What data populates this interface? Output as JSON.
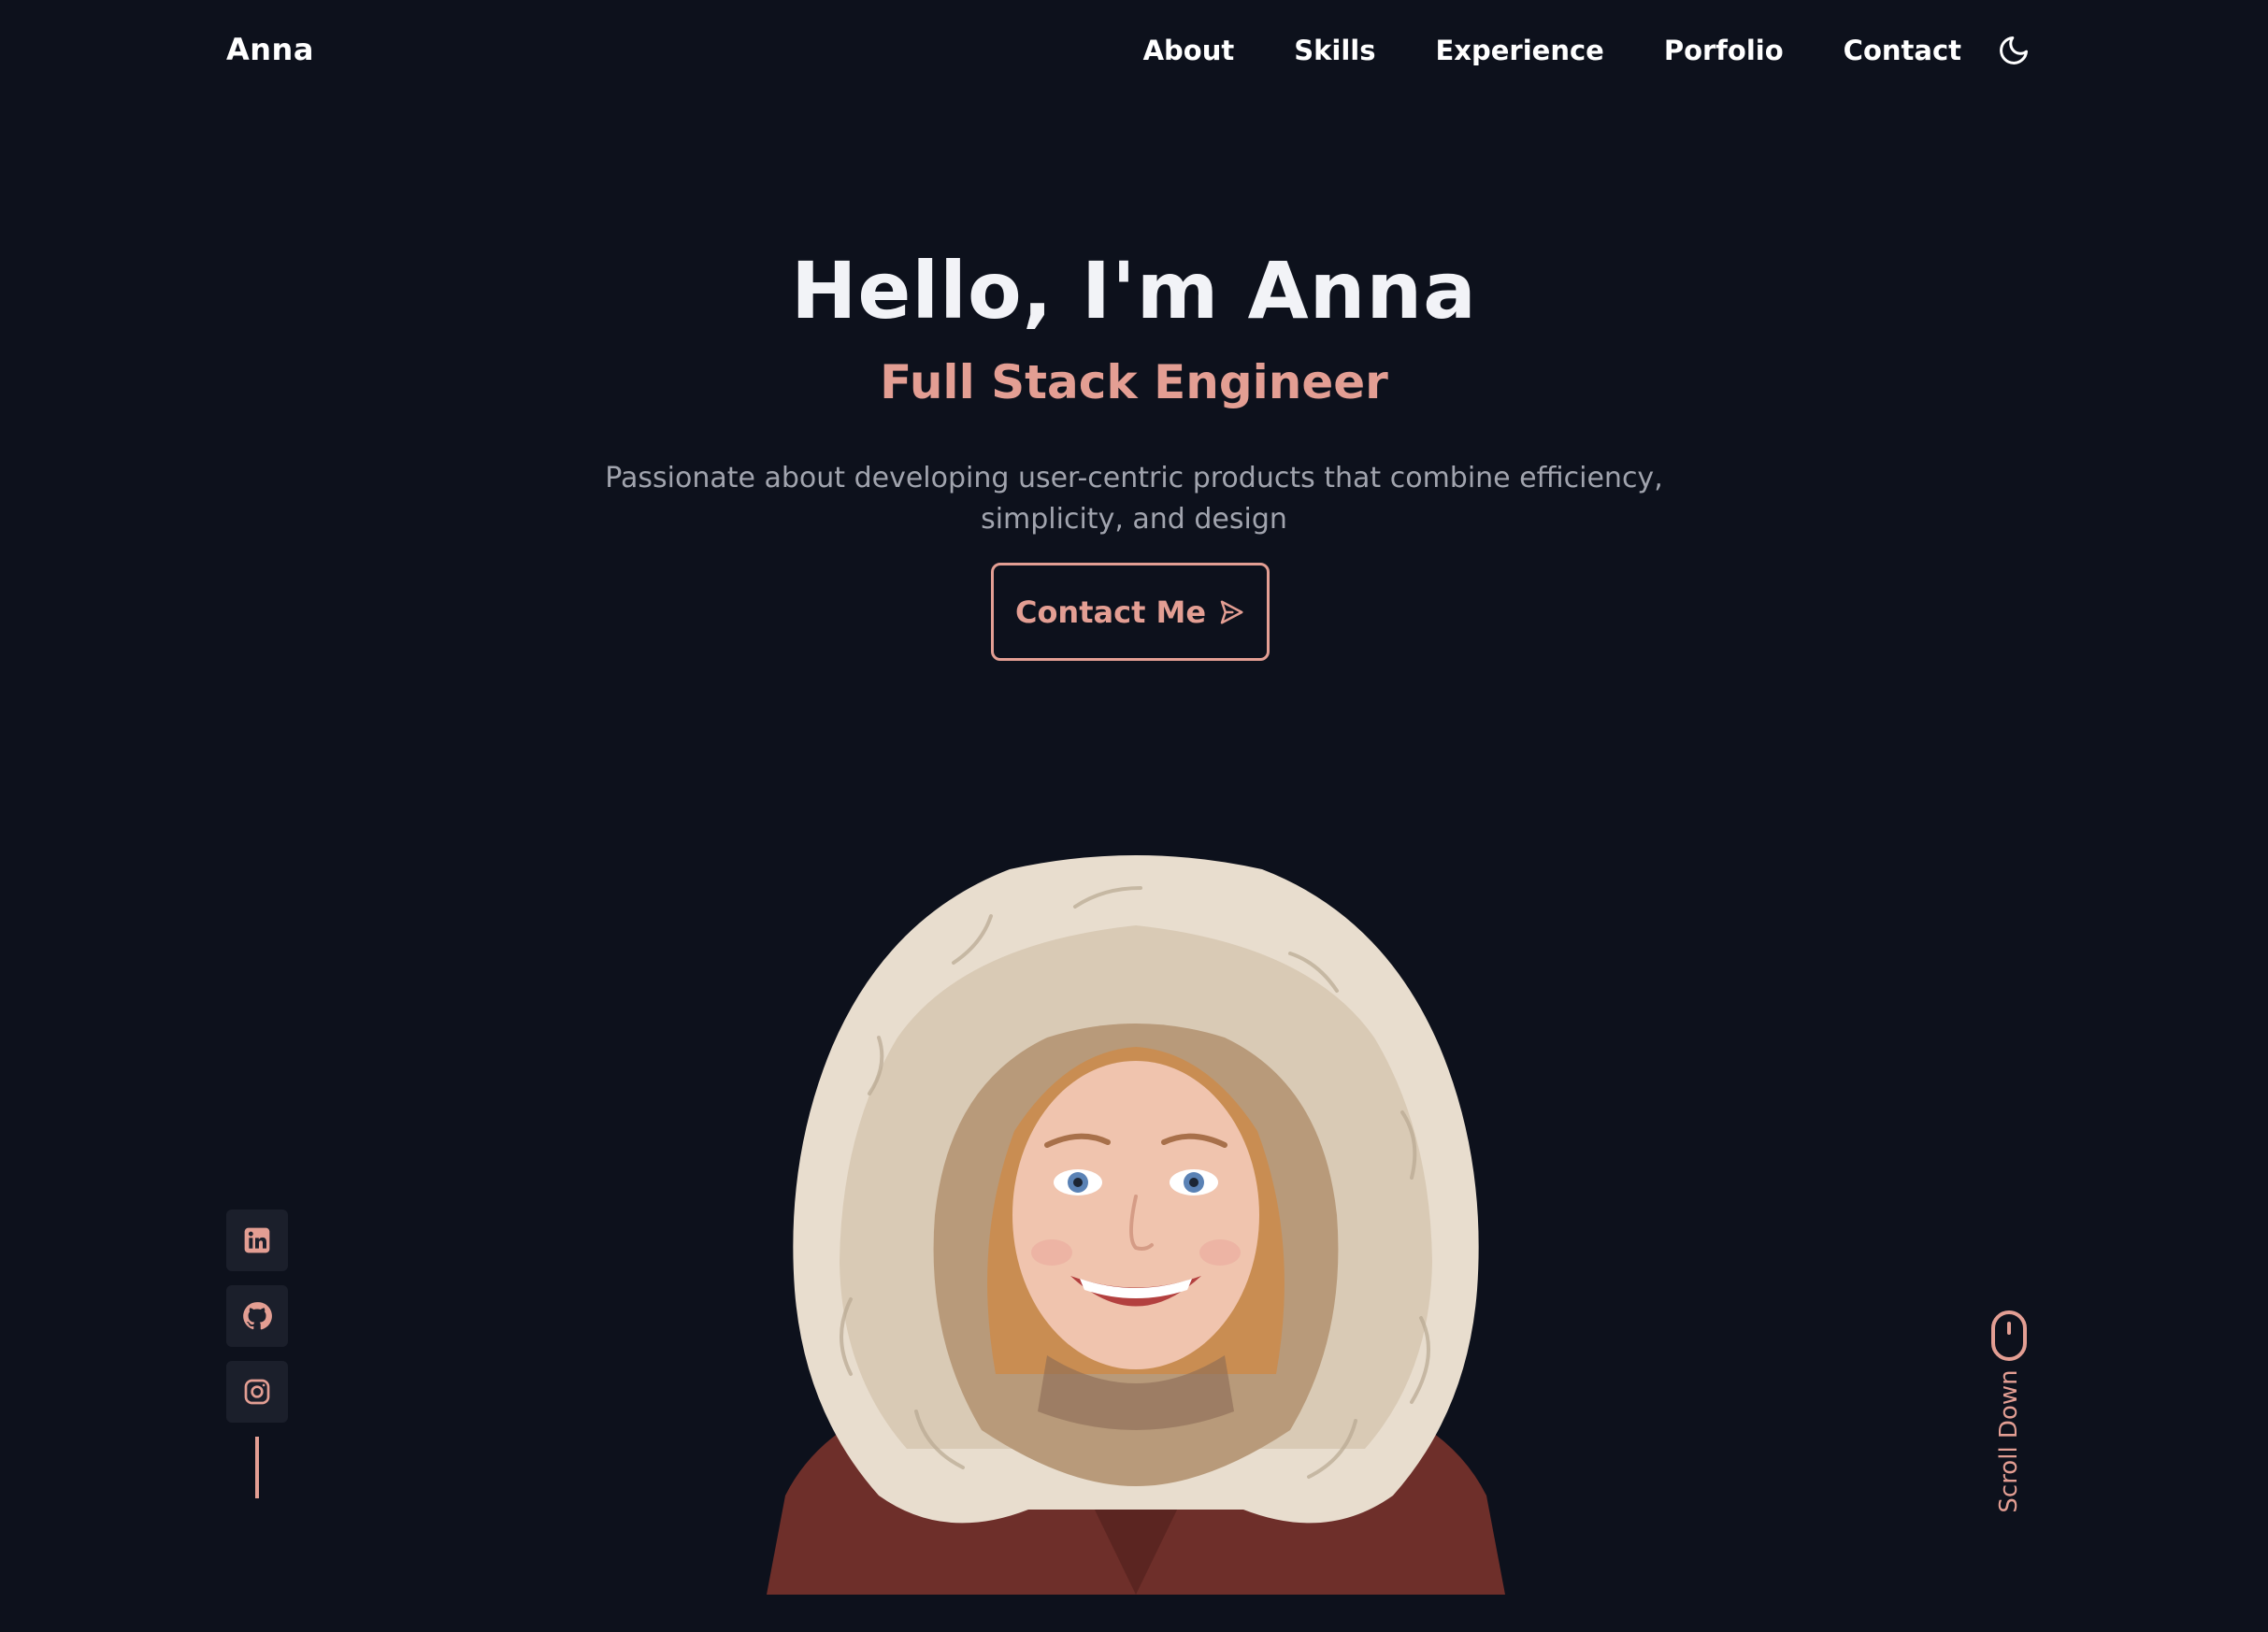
{
  "header": {
    "logo": "Anna",
    "nav": [
      {
        "label": "About"
      },
      {
        "label": "Skills"
      },
      {
        "label": "Experience"
      },
      {
        "label": "Porfolio"
      },
      {
        "label": "Contact"
      }
    ],
    "theme_icon": "moon-icon"
  },
  "hero": {
    "title": "Hello, I'm Anna",
    "subtitle": "Full Stack Engineer",
    "description": "Passionate about developing user-centric products that combine efficiency, simplicity, and design",
    "cta_label": "Contact Me",
    "cta_icon": "send-icon",
    "portrait_icon": "profile-portrait"
  },
  "social": {
    "links": [
      {
        "icon": "linkedin-icon"
      },
      {
        "icon": "github-icon"
      },
      {
        "icon": "instagram-icon"
      }
    ]
  },
  "scroll": {
    "label": "Scroll Down",
    "icon": "mouse-icon"
  },
  "colors": {
    "background": "#0d111c",
    "accent": "#e39e93",
    "text": "#f2f3f7",
    "muted": "#a1a4ae",
    "social_bg": "#1b1f2b"
  }
}
